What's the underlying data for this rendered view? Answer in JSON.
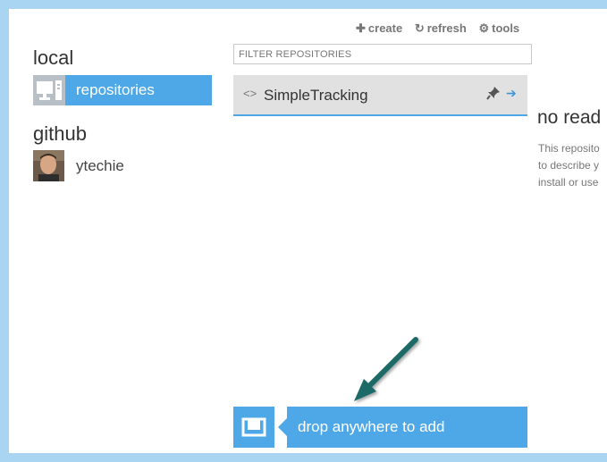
{
  "sidebar": {
    "local_heading": "local",
    "repositories_label": "repositories",
    "github_heading": "github",
    "user_label": "ytechie"
  },
  "toolbar": {
    "create_label": "create",
    "refresh_label": "refresh",
    "tools_label": "tools"
  },
  "filter": {
    "placeholder": "FILTER REPOSITORIES"
  },
  "repositories": [
    {
      "name": "SimpleTracking"
    }
  ],
  "detail": {
    "title": "no read",
    "lines": [
      "This reposito",
      "to describe y",
      "install or use"
    ]
  },
  "drop": {
    "label": "drop anywhere to add"
  },
  "colors": {
    "accent": "#4ea8e8",
    "frame": "#a9d4f2",
    "annotation_arrow": "#1f6a67"
  }
}
